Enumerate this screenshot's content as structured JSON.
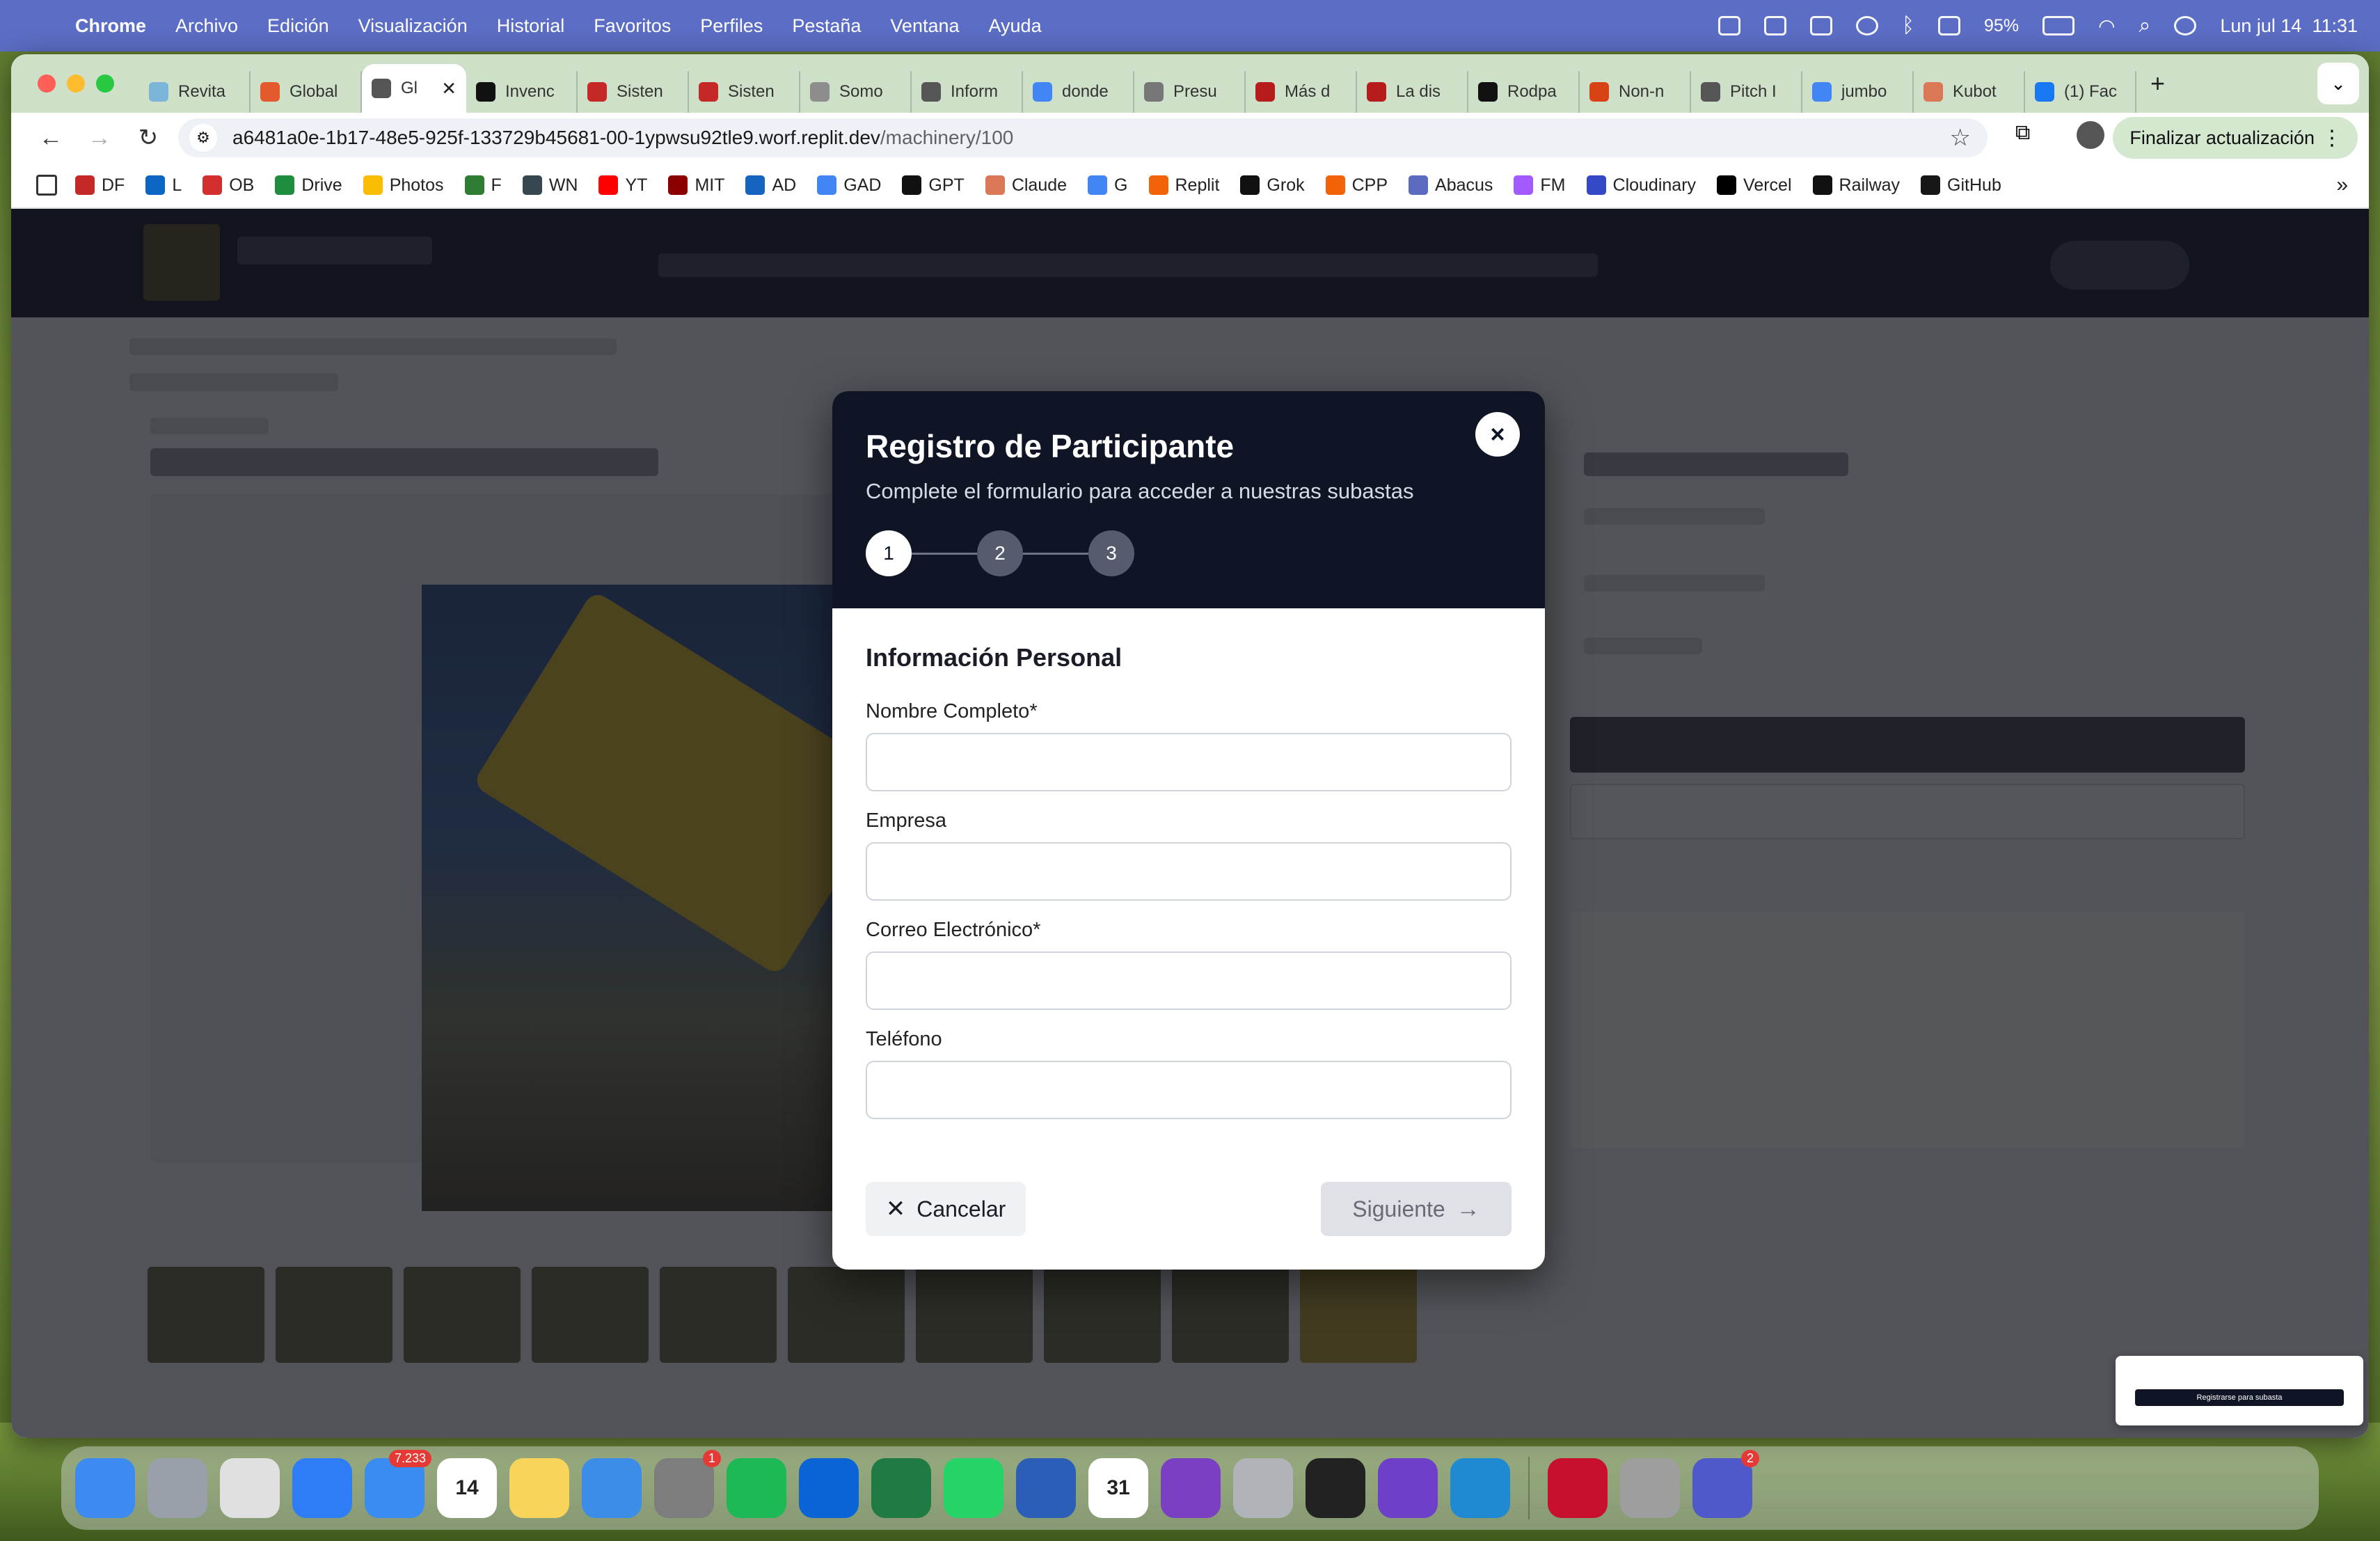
{
  "menubar": {
    "app": "Chrome",
    "items": [
      "Archivo",
      "Edición",
      "Visualización",
      "Historial",
      "Favoritos",
      "Perfiles",
      "Pestaña",
      "Ventana",
      "Ayuda"
    ],
    "battery": "95%",
    "datetime": "Lun jul 14  11:31"
  },
  "tabs": [
    {
      "label": "Revita",
      "color": "#7bb6d9"
    },
    {
      "label": "Global",
      "color": "#e35b2d"
    },
    {
      "label": "Gl",
      "color": "#555555",
      "active": true
    },
    {
      "label": "Invenc",
      "color": "#111111"
    },
    {
      "label": "Sisten",
      "color": "#c62828"
    },
    {
      "label": "Sisten",
      "color": "#c62828"
    },
    {
      "label": "Somo",
      "color": "#8d8d8d"
    },
    {
      "label": "Inform",
      "color": "#555555"
    },
    {
      "label": "donde",
      "color": "#4285f4"
    },
    {
      "label": "Presu",
      "color": "#777777"
    },
    {
      "label": "Más d",
      "color": "#b71c1c"
    },
    {
      "label": "La dis",
      "color": "#b71c1c"
    },
    {
      "label": "Rodpa",
      "color": "#111111"
    },
    {
      "label": "Non-n",
      "color": "#d84315"
    },
    {
      "label": "Pitch I",
      "color": "#555555"
    },
    {
      "label": "jumbo",
      "color": "#4285f4"
    },
    {
      "label": "Kubot",
      "color": "#d97757"
    },
    {
      "label": "(1) Fac",
      "color": "#1877f2"
    }
  ],
  "toolbar": {
    "url_host": "a6481a0e-1b17-48e5-925f-133729b45681-00-1ypwsu92tle9.worf.replit.dev",
    "url_path": "/machinery/100",
    "update_label": "Finalizar actualización"
  },
  "bookmarks": [
    {
      "label": "DF",
      "color": "#c62828"
    },
    {
      "label": "L",
      "color": "#0a66c2"
    },
    {
      "label": "OB",
      "color": "#d32f2f"
    },
    {
      "label": "Drive",
      "color": "#1e8e3e"
    },
    {
      "label": "Photos",
      "color": "#fbbc04"
    },
    {
      "label": "F",
      "color": "#2e7d32"
    },
    {
      "label": "WN",
      "color": "#37474f"
    },
    {
      "label": "YT",
      "color": "#ff0000"
    },
    {
      "label": "MIT",
      "color": "#8b0000"
    },
    {
      "label": "AD",
      "color": "#1565c0"
    },
    {
      "label": "GAD",
      "color": "#4285f4"
    },
    {
      "label": "GPT",
      "color": "#111111"
    },
    {
      "label": "Claude",
      "color": "#d97757"
    },
    {
      "label": "G",
      "color": "#4285f4"
    },
    {
      "label": "Replit",
      "color": "#f26207"
    },
    {
      "label": "Grok",
      "color": "#111111"
    },
    {
      "label": "CPP",
      "color": "#f26207"
    },
    {
      "label": "Abacus",
      "color": "#5c6bc0"
    },
    {
      "label": "FM",
      "color": "#a259ff"
    },
    {
      "label": "Cloudinary",
      "color": "#3448c5"
    },
    {
      "label": "Vercel",
      "color": "#000000"
    },
    {
      "label": "Railway",
      "color": "#111111"
    },
    {
      "label": "GitHub",
      "color": "#181717"
    }
  ],
  "modal": {
    "title": "Registro de Participante",
    "subtitle": "Complete el formulario para acceder a nuestras subastas",
    "steps": [
      "1",
      "2",
      "3"
    ],
    "current_step": 1,
    "section": "Información Personal",
    "fields": [
      {
        "label": "Nombre Completo*",
        "value": "",
        "placeholder": ""
      },
      {
        "label": "Empresa",
        "value": "",
        "placeholder": ""
      },
      {
        "label": "Correo Electrónico*",
        "value": "",
        "placeholder": ""
      },
      {
        "label": "Teléfono",
        "value": "",
        "placeholder": ""
      }
    ],
    "cancel_label": "Cancelar",
    "next_label": "Siguiente",
    "close_icon": "×"
  },
  "dock": {
    "apps": [
      {
        "name": "finder",
        "color": "#3d8bf0"
      },
      {
        "name": "launchpad",
        "color": "#9aa0aa"
      },
      {
        "name": "chrome",
        "color": "#e0e0e0"
      },
      {
        "name": "safari",
        "color": "#2f7df6"
      },
      {
        "name": "mail",
        "color": "#3b8cf2",
        "badge": "7.233"
      },
      {
        "name": "calendar",
        "color": "#ffffff",
        "label": "14"
      },
      {
        "name": "notes",
        "color": "#f8d55a"
      },
      {
        "name": "keynote",
        "color": "#3c8de8"
      },
      {
        "name": "system-settings",
        "color": "#7d7d7d",
        "badge": "1"
      },
      {
        "name": "spotify",
        "color": "#1db954"
      },
      {
        "name": "outlook",
        "color": "#0a64d6"
      },
      {
        "name": "excel",
        "color": "#1f7a43"
      },
      {
        "name": "whatsapp",
        "color": "#25d366"
      },
      {
        "name": "word",
        "color": "#2b5fb7"
      },
      {
        "name": "calendar-31",
        "color": "#ffffff",
        "label": "31"
      },
      {
        "name": "screen-recorder",
        "color": "#7a3fc2"
      },
      {
        "name": "iphone-mirroring",
        "color": "#b0b3b8"
      },
      {
        "name": "app-grid",
        "color": "#222222"
      },
      {
        "name": "github-desktop",
        "color": "#6e40c9"
      },
      {
        "name": "vscode",
        "color": "#1f8ad2"
      },
      {
        "name": "acrobat",
        "color": "#c8102e"
      },
      {
        "name": "pro-app",
        "color": "#9e9e9e"
      },
      {
        "name": "teams",
        "color": "#5059c9",
        "badge": "2"
      }
    ]
  },
  "preview": {
    "button": "Registrarse para subasta"
  }
}
